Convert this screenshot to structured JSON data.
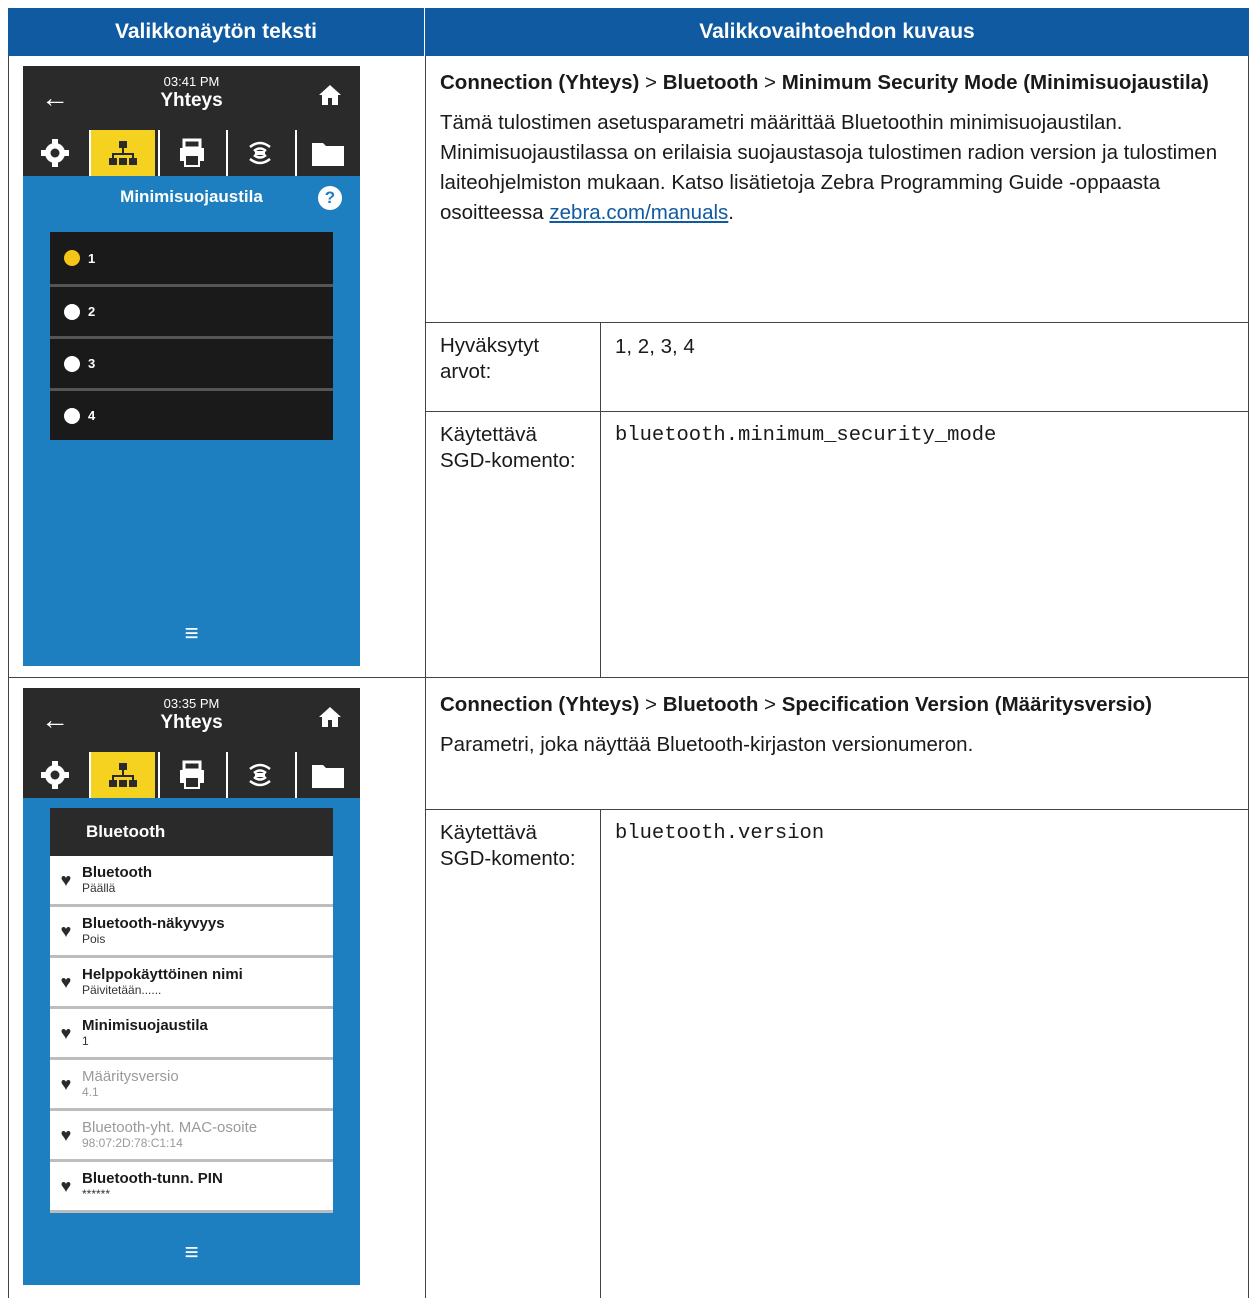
{
  "header": {
    "col1": "Valikkonäytön teksti",
    "col2": "Valikkovaihtoehdon kuvaus"
  },
  "row1": {
    "screen": {
      "time": "03:41 PM",
      "title": "Yhteys",
      "menu_title": "Minimisuojaustila",
      "options": [
        "1",
        "2",
        "3",
        "4"
      ],
      "selected": "1",
      "icons": [
        "back-arrow-icon",
        "home-icon",
        "gear-icon",
        "network-icon",
        "printer-icon",
        "wireless-icon",
        "folder-icon",
        "help-icon",
        "hamburger-menu-icon"
      ]
    },
    "path": {
      "a": "Connection (Yhteys)",
      "sep1": " > ",
      "b": "Bluetooth",
      "sep2": " > ",
      "c": "Minimum Security Mode (Minimisuojaustila)"
    },
    "description": "Tämä tulostimen asetusparametri määrittää Bluetoothin minimisuojaustilan. Minimisuojaustilassa on erilaisia suojaustasoja tulostimen radion version ja tulostimen laiteohjelmiston mukaan. Katso lisätietoja Zebra Programming Guide -oppaasta osoitteessa ",
    "link": "zebra.com/manuals",
    "desc_end": ".",
    "accepted_label": "Hyväksytyt arvot:",
    "accepted_value": "1, 2, 3, 4",
    "sgd_label": "Käytettävä SGD-komento:",
    "sgd_value": "bluetooth.minimum_security_mode"
  },
  "row2": {
    "screen": {
      "time": "03:35 PM",
      "title": "Yhteys",
      "section_title": "Bluetooth",
      "items": [
        {
          "label": "Bluetooth",
          "value": "Päällä",
          "dim": false
        },
        {
          "label": "Bluetooth-näkyvyys",
          "value": "Pois",
          "dim": false
        },
        {
          "label": "Helppokäyttöinen nimi",
          "value": "Päivitetään......",
          "dim": false
        },
        {
          "label": "Minimisuojaustila",
          "value": "1",
          "dim": false
        },
        {
          "label": "Määritysversio",
          "value": "4.1",
          "dim": true
        },
        {
          "label": "Bluetooth-yht. MAC-osoite",
          "value": "98:07:2D:78:C1:14",
          "dim": true
        },
        {
          "label": "Bluetooth-tunn. PIN",
          "value": "******",
          "dim": false
        }
      ]
    },
    "path": {
      "a": "Connection (Yhteys)",
      "sep1": " > ",
      "b": "Bluetooth",
      "sep2": " > ",
      "c": "Specification Version (Määritysversio)"
    },
    "description": "Parametri, joka näyttää Bluetooth-kirjaston versionumeron.",
    "sgd_label": "Käytettävä SGD-komento:",
    "sgd_value": "bluetooth.version"
  }
}
